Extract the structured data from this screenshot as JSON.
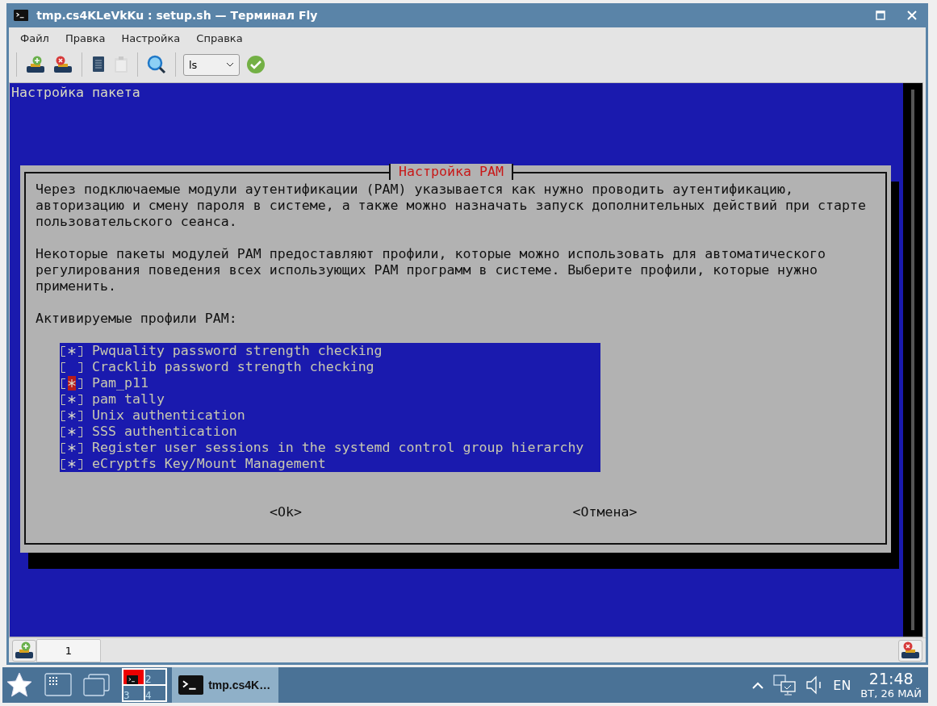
{
  "window": {
    "title": "tmp.cs4KLeVkKu : setup.sh — Терминал Fly"
  },
  "menu": [
    "Файл",
    "Правка",
    "Настройка",
    "Справка"
  ],
  "toolbar": {
    "command": "ls",
    "paste_disabled": true
  },
  "terminal": {
    "header": "Настройка пакета",
    "dialog": {
      "title": "Настройка PAM",
      "paragraphs": [
        "Через подключаемые модули аутентификации (PAM) указывается как нужно проводить аутентификацию, авторизацию и смену пароля в системе, а также можно назначать запуск дополнительных действий при старте пользовательского сеанса.",
        "Некоторые пакеты модулей PAM предоставляют профили, которые можно использовать для автоматического регулирования поведения всех использующих PAM программ в системе. Выберите профили, которые нужно применить.",
        "Активируемые профили PAM:"
      ],
      "profiles": [
        {
          "label": "Pwquality password strength checking",
          "checked": true,
          "selected": false
        },
        {
          "label": "Cracklib password strength checking",
          "checked": false,
          "selected": false
        },
        {
          "label": "Pam_p11",
          "checked": true,
          "selected": true
        },
        {
          "label": "pam tally",
          "checked": true,
          "selected": false
        },
        {
          "label": "Unix authentication",
          "checked": true,
          "selected": false
        },
        {
          "label": "SSS authentication",
          "checked": true,
          "selected": false
        },
        {
          "label": "Register user sessions in the systemd control group hierarchy",
          "checked": true,
          "selected": false
        },
        {
          "label": "eCryptfs Key/Mount Management",
          "checked": true,
          "selected": false
        }
      ],
      "buttons": [
        "<Ok>",
        "<Отмена>"
      ]
    }
  },
  "tabs": [
    {
      "label": "1",
      "selected": true
    }
  ],
  "taskbar": {
    "desktops": [
      {
        "selected": true
      },
      {
        "label": "2",
        "selected": false
      },
      {
        "label": "3",
        "selected": false
      },
      {
        "label": "4",
        "selected": false
      }
    ],
    "task": "tmp.cs4K…",
    "language": "EN",
    "time": "21:48",
    "date": "ВТ, 26 МАЙ"
  }
}
